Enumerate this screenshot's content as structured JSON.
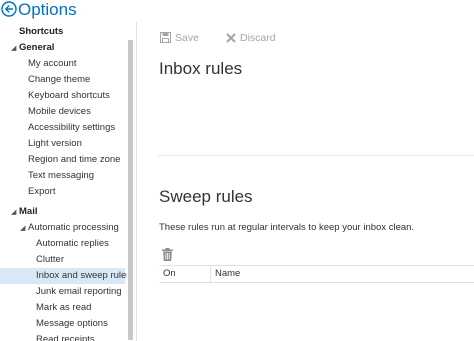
{
  "app": {
    "title": "Options"
  },
  "sidebar": {
    "items": [
      {
        "label": "Shortcuts",
        "type": "section"
      },
      {
        "label": "General",
        "type": "section",
        "caret": "◢"
      },
      {
        "label": "My account"
      },
      {
        "label": "Change theme"
      },
      {
        "label": "Keyboard shortcuts"
      },
      {
        "label": "Mobile devices"
      },
      {
        "label": "Accessibility settings"
      },
      {
        "label": "Light version"
      },
      {
        "label": "Region and time zone"
      },
      {
        "label": "Text messaging"
      },
      {
        "label": "Export"
      },
      {
        "label": "Mail",
        "type": "section",
        "caret": "◢"
      },
      {
        "label": "Automatic processing",
        "caret": "◢"
      },
      {
        "label": "Automatic replies"
      },
      {
        "label": "Clutter"
      },
      {
        "label": "Inbox and sweep rules",
        "selected": true
      },
      {
        "label": "Junk email reporting"
      },
      {
        "label": "Mark as read"
      },
      {
        "label": "Message options"
      },
      {
        "label": "Read receipts"
      }
    ]
  },
  "toolbar": {
    "save_label": "Save",
    "discard_label": "Discard"
  },
  "main": {
    "inbox_rules_title": "Inbox rules",
    "sweep_rules_title": "Sweep rules",
    "sweep_description": "These rules run at regular intervals to keep your inbox clean.",
    "table": {
      "col_on": "On",
      "col_name": "Name"
    }
  },
  "colors": {
    "accent": "#0072c6",
    "selected_bg": "#d9e8f7"
  }
}
